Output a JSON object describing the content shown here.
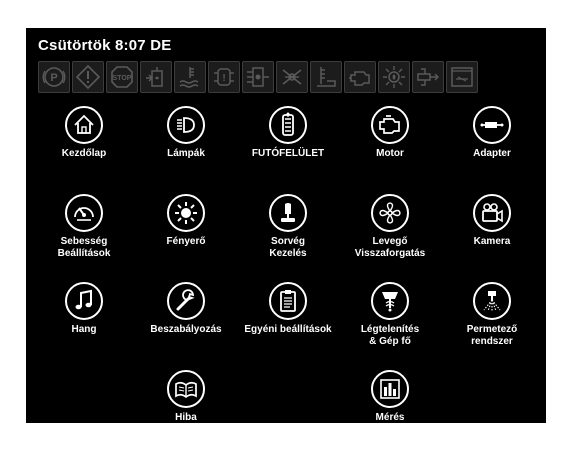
{
  "status": {
    "day_time": "Csütörtök 8:07 DE"
  },
  "warning_icons": [
    "parking-brake-icon",
    "warning-triangle-icon",
    "stop-icon",
    "fuel-filter-icon",
    "coolant-level-icon",
    "transmission-fault-icon",
    "hydraulic-fault-icon",
    "steering-fault-icon",
    "hydraulic-oil-temp-icon",
    "engine-check-icon",
    "oil-pressure-icon",
    "adapter-icon",
    "message-icon"
  ],
  "tiles": [
    {
      "name": "home-icon",
      "label": "Kezdőlap"
    },
    {
      "name": "headlight-icon",
      "label": "Lámpák"
    },
    {
      "name": "tread-icon",
      "label": "FUTÓFELÜLET"
    },
    {
      "name": "engine-icon",
      "label": "Motor"
    },
    {
      "name": "adapter-icon",
      "label": "Adapter"
    },
    {
      "name": "speedometer-icon",
      "label": "Sebesség\nBeállítások"
    },
    {
      "name": "brightness-icon",
      "label": "Fényerő"
    },
    {
      "name": "joystick-icon",
      "label": "Sorvég\nKezelés"
    },
    {
      "name": "fan-icon",
      "label": "Levegő\nVisszaforgatás"
    },
    {
      "name": "camera-icon",
      "label": "Kamera"
    },
    {
      "name": "music-note-icon",
      "label": "Hang"
    },
    {
      "name": "wrench-icon",
      "label": "Beszabályozás"
    },
    {
      "name": "clipboard-icon",
      "label": "Egyéni beállítások"
    },
    {
      "name": "boom-fan-icon",
      "label": "Légtelenítés\n& Gép fő"
    },
    {
      "name": "sprayer-icon",
      "label": "Permetező\nrendszer"
    },
    {
      "name": "book-icon",
      "label": "Hiba"
    },
    {
      "name": "bar-chart-icon",
      "label": "Mérés"
    }
  ]
}
